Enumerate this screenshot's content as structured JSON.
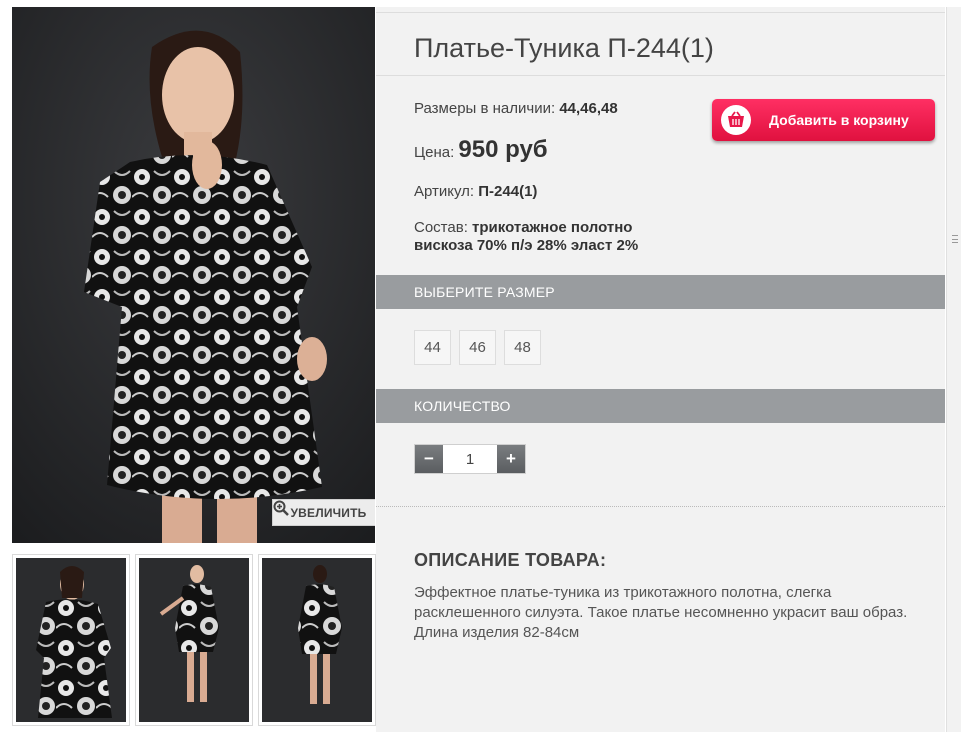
{
  "product": {
    "title": "Платье-Туника П-244(1)",
    "sizes_label": "Размеры в наличии:",
    "sizes_value": "44,46,48",
    "price_label": "Цена:",
    "price_value": "950 руб",
    "sku_label": "Артикул:",
    "sku_value": "П-244(1)",
    "composition_label": "Состав:",
    "composition_line1": "трикотажное полотно",
    "composition_line2": "вискоза 70% п/э 28% эласт 2%"
  },
  "cart_button": {
    "label": "Добавить в корзину",
    "icon": "basket-icon",
    "color": "#e8174a"
  },
  "gallery": {
    "zoom_label": "УВЕЛИЧИТЬ",
    "zoom_icon": "magnifier-plus-icon",
    "thumbnail_count": 3
  },
  "size_section": {
    "header": "ВЫБЕРИТЕ РАЗМЕР",
    "options": [
      "44",
      "46",
      "48"
    ]
  },
  "quantity_section": {
    "header": "КОЛИЧЕСТВО",
    "minus": "−",
    "plus": "+",
    "value": "1"
  },
  "description": {
    "heading": "ОПИСАНИЕ ТОВАРА:",
    "text": "Эффектное платье-туника из трикотажного полотна, слегка расклешенного силуэта. Такое платье несомненно украсит ваш образ. Длина изделия 82-84см"
  },
  "colors": {
    "bar": "#999c9f",
    "panel": "#f2f2f2",
    "accent": "#e8174a"
  }
}
